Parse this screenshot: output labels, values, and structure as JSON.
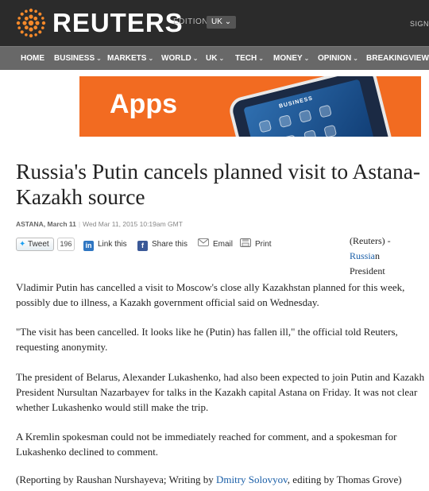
{
  "header": {
    "logo_text": "REUTERS",
    "edition_label": "EDITION:",
    "edition_value": "UK",
    "signin": "SIGN"
  },
  "nav": {
    "items": [
      {
        "label": "HOME",
        "dropdown": false
      },
      {
        "label": "BUSINESS",
        "dropdown": true
      },
      {
        "label": "MARKETS",
        "dropdown": true
      },
      {
        "label": "WORLD",
        "dropdown": true
      },
      {
        "label": "UK",
        "dropdown": true
      },
      {
        "label": "TECH",
        "dropdown": true
      },
      {
        "label": "MONEY",
        "dropdown": true
      },
      {
        "label": "OPINION",
        "dropdown": true
      },
      {
        "label": "BREAKINGVIEWS",
        "dropdown": false
      }
    ]
  },
  "banner": {
    "text": "Apps",
    "phone_label": "BUSINESS",
    "color": "#f26b21"
  },
  "article": {
    "headline": "Russia's Putin cancels planned visit to Astana- Kazakh source",
    "location": "ASTANA, March 11",
    "timestamp": "Wed Mar 11, 2015 10:19am GMT",
    "share": {
      "tweet_label": "Tweet",
      "tweet_count": "196",
      "linkedin_label": "Link this",
      "facebook_label": "Share this",
      "email_label": "Email",
      "print_label": "Print"
    },
    "side_snippet": {
      "source": "(Reuters) -",
      "link_text": "Russia",
      "link_rest": "n",
      "after": "President"
    },
    "paragraphs": [
      "Vladimir Putin has cancelled a visit to Moscow's close ally Kazakhstan planned for this week, possibly due to illness, a Kazakh government official said on Wednesday.",
      "\"The visit has been cancelled. It looks like he (Putin) has fallen ill,\" the official told Reuters, requesting anonymity.",
      "The president of Belarus, Alexander Lukashenko, had also been expected to join Putin and Kazakh President Nursultan Nazarbayev for talks in the Kazakh capital Astana on Friday. It was not clear whether Lukashenko would still make the trip.",
      "A Kremlin spokesman could not be immediately reached for comment, and a spokesman for Lukashenko declined to comment."
    ],
    "credit": {
      "before": "(Reporting by Raushan Nurshayeva; Writing by ",
      "link": "Dmitry Solovyov",
      "after": ", editing by Thomas Grove)"
    }
  },
  "colors": {
    "topbar": "#2b2b2b",
    "navbar": "#686868",
    "link": "#1a5fa8"
  }
}
